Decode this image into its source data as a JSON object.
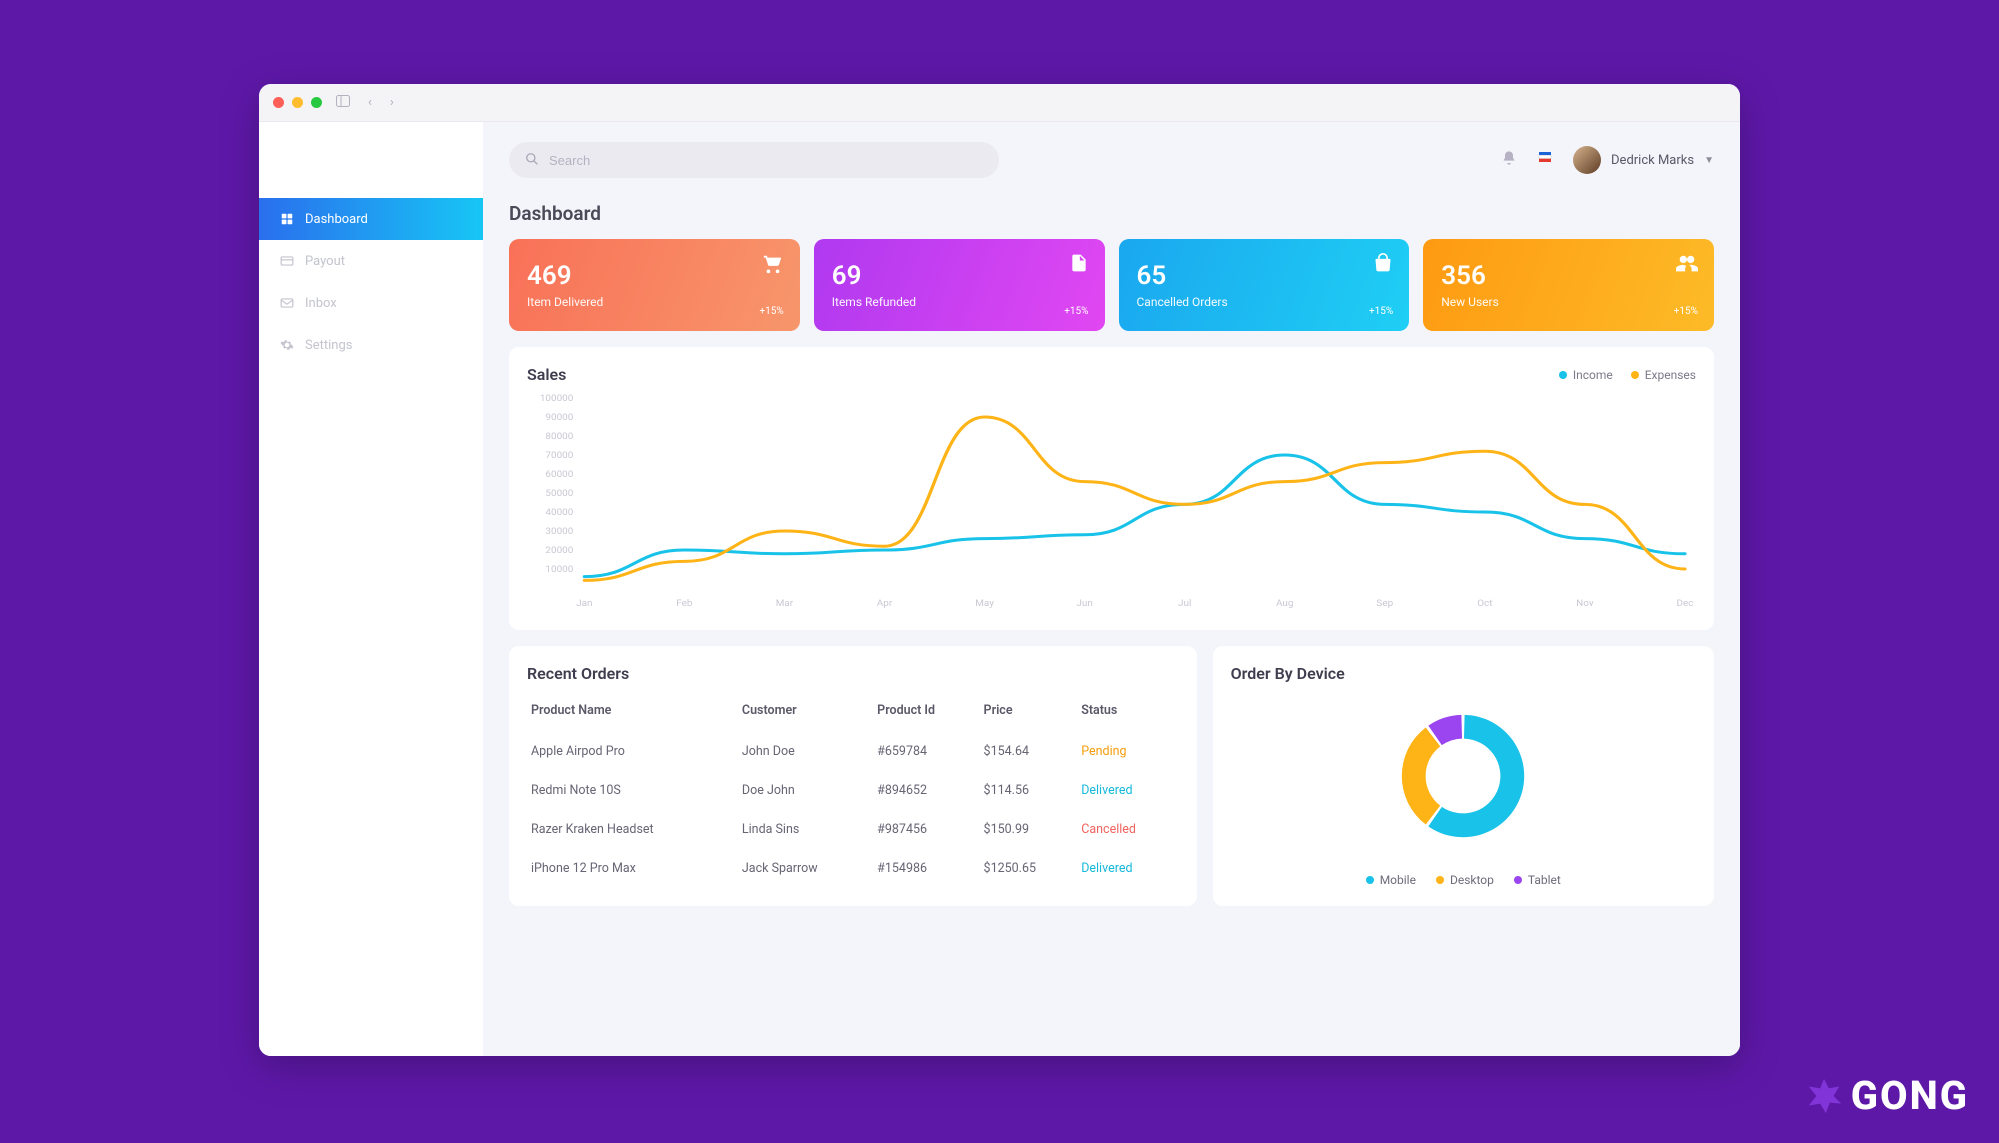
{
  "topbar": {
    "search_placeholder": "Search",
    "user_name": "Dedrick Marks"
  },
  "sidebar": {
    "items": [
      {
        "label": "Dashboard",
        "icon": "grid-icon",
        "active": true
      },
      {
        "label": "Payout",
        "icon": "credit-card-icon",
        "active": false
      },
      {
        "label": "Inbox",
        "icon": "envelope-icon",
        "active": false
      },
      {
        "label": "Settings",
        "icon": "gear-icon",
        "active": false
      }
    ]
  },
  "page": {
    "title": "Dashboard"
  },
  "cards": [
    {
      "value": "469",
      "label": "Item Delivered",
      "delta": "+15%",
      "icon": "cart-icon"
    },
    {
      "value": "69",
      "label": "Items Refunded",
      "delta": "+15%",
      "icon": "file-icon"
    },
    {
      "value": "65",
      "label": "Cancelled Orders",
      "delta": "+15%",
      "icon": "bag-icon"
    },
    {
      "value": "356",
      "label": "New Users",
      "delta": "+15%",
      "icon": "users-icon"
    }
  ],
  "sales": {
    "title": "Sales",
    "legend": [
      {
        "label": "Income",
        "color": "#18c2e8"
      },
      {
        "label": "Expenses",
        "color": "#feb317"
      }
    ]
  },
  "orders": {
    "title": "Recent Orders",
    "headers": [
      "Product Name",
      "Customer",
      "Product Id",
      "Price",
      "Status"
    ],
    "rows": [
      {
        "product": "Apple Airpod Pro",
        "customer": "John Doe",
        "id": "#659784",
        "price": "$154.64",
        "status": "Pending",
        "status_class": "st-pending"
      },
      {
        "product": "Redmi Note 10S",
        "customer": "Doe John",
        "id": "#894652",
        "price": "$114.56",
        "status": "Delivered",
        "status_class": "st-delivered"
      },
      {
        "product": "Razer Kraken Headset",
        "customer": "Linda Sins",
        "id": "#987456",
        "price": "$150.99",
        "status": "Cancelled",
        "status_class": "st-cancelled"
      },
      {
        "product": "iPhone 12 Pro Max",
        "customer": "Jack Sparrow",
        "id": "#154986",
        "price": "$1250.65",
        "status": "Delivered",
        "status_class": "st-delivered"
      }
    ]
  },
  "device": {
    "title": "Order By Device",
    "legend": [
      {
        "label": "Mobile",
        "color": "#18c2e8"
      },
      {
        "label": "Desktop",
        "color": "#feb317"
      },
      {
        "label": "Tablet",
        "color": "#9b45f0"
      }
    ]
  },
  "chart_data": [
    {
      "type": "line",
      "title": "Sales",
      "xlabel": "",
      "ylabel": "",
      "ylim": [
        0,
        100000
      ],
      "y_ticks": [
        10000,
        20000,
        30000,
        40000,
        50000,
        60000,
        70000,
        80000,
        90000,
        100000
      ],
      "categories": [
        "Jan",
        "Feb",
        "Mar",
        "Apr",
        "May",
        "Jun",
        "Jul",
        "Aug",
        "Sep",
        "Oct",
        "Nov",
        "Dec"
      ],
      "series": [
        {
          "name": "Income",
          "color": "#18c2e8",
          "values": [
            6000,
            20000,
            18000,
            20000,
            26000,
            28000,
            44000,
            70000,
            44000,
            40000,
            26000,
            18000
          ]
        },
        {
          "name": "Expenses",
          "color": "#feb317",
          "values": [
            4000,
            14000,
            30000,
            22000,
            90000,
            56000,
            44000,
            56000,
            66000,
            72000,
            44000,
            10000
          ]
        }
      ]
    },
    {
      "type": "pie",
      "title": "Order By Device",
      "series": [
        {
          "name": "Mobile",
          "value": 60,
          "color": "#18c2e8"
        },
        {
          "name": "Desktop",
          "value": 30,
          "color": "#feb317"
        },
        {
          "name": "Tablet",
          "value": 10,
          "color": "#9b45f0"
        }
      ]
    }
  ],
  "brand": "GONG"
}
